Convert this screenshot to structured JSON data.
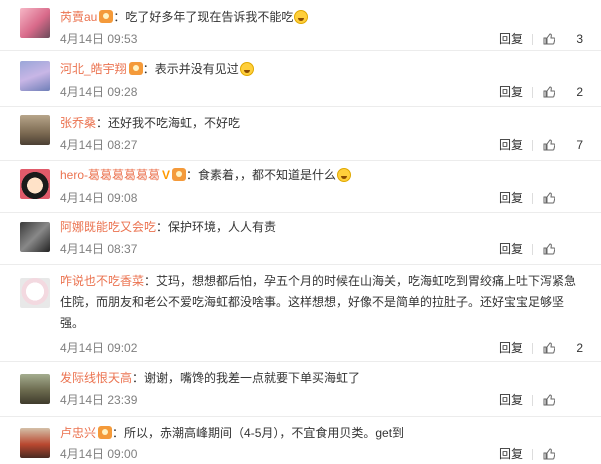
{
  "reply_label": "回复",
  "comments": [
    {
      "user": "芮賣au",
      "text": "吃了好多年了现在告诉我不能吃",
      "emoji": true,
      "time": "4月14日 09:53",
      "likes": "3",
      "verified": false
    },
    {
      "user": "河北_皓宇翔",
      "text": "表示并没有见过",
      "emoji": true,
      "time": "4月14日 09:28",
      "likes": "2",
      "verified": false
    },
    {
      "user": "张乔桑",
      "text": "还好我不吃海虹，不好吃",
      "emoji": false,
      "time": "4月14日 08:27",
      "likes": "7",
      "verified": false
    },
    {
      "user": "hero-葛葛葛葛葛葛",
      "text": "食素着，，都不知道是什么",
      "emoji": true,
      "time": "4月14日 09:08",
      "likes": "",
      "verified": true
    },
    {
      "user": "阿娜既能吃又会吃",
      "text": "保护环境，人人有责",
      "emoji": false,
      "time": "4月14日 08:37",
      "likes": "",
      "verified": false
    },
    {
      "user": "咋说也不吃香菜",
      "text_line1": "艾玛，想想都后怕，孕五个月的时候在山海关，吃海虹吃到胃绞痛上吐下泻紧急",
      "text_line2": "住院，而朋友和老公不爱吃海虹都没啥事。这样想想，好像不是简单的拉肚子。还好宝宝足够坚",
      "text_line3": "强。",
      "time": "4月14日 09:02",
      "likes": "2",
      "verified": false
    },
    {
      "user": "发际线恨天高",
      "text": "谢谢，嘴馋的我差一点就要下单买海虹了",
      "emoji": false,
      "time": "4月14日 23:39",
      "likes": "",
      "verified": false
    },
    {
      "user": "卢忠兴",
      "text": "所以，赤潮高峰期间（4-5月），不宜食用贝类。get到",
      "emoji": false,
      "time": "4月14日 09:00",
      "likes": "",
      "verified": false
    }
  ],
  "colors": {
    "username": "#eb7350",
    "time": "#808080",
    "badge": "#f49a3a"
  }
}
